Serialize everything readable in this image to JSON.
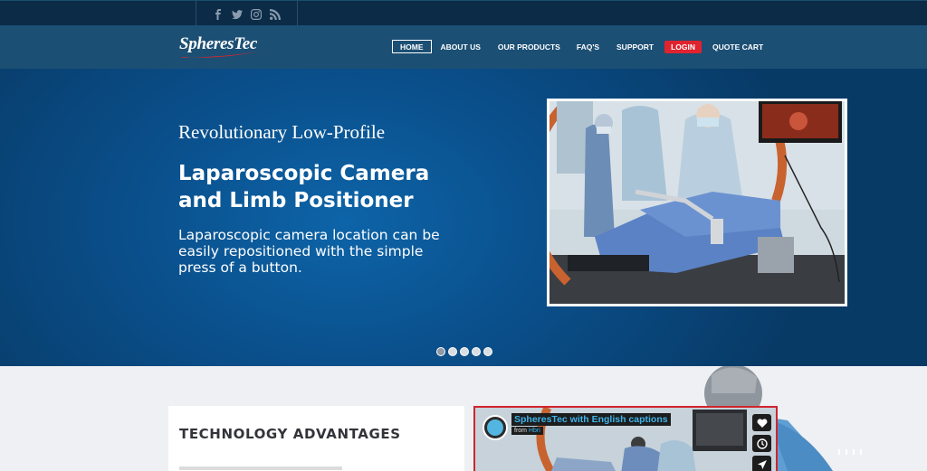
{
  "social": {
    "icons": [
      "facebook-icon",
      "twitter-icon",
      "instagram-icon",
      "rss-icon"
    ]
  },
  "header": {
    "logo_text": "SpheresTec",
    "menu": {
      "home": "HOME",
      "about": "ABOUT US",
      "products": "OUR PRODUCTS",
      "faq": "FAQ'S",
      "support": "SUPPORT",
      "login": "LOGIN",
      "quote_cart": "QUOTE CART"
    }
  },
  "hero": {
    "kicker": "Revolutionary Low-Profile",
    "title": "Laparoscopic Camera and Limb Positioner",
    "description": "Laparoscopic camera location can be easily repositioned with the simple press of a button.",
    "slide_count": 5,
    "active_slide": 1
  },
  "advantages": {
    "title": "TECHNOLOGY ADVANTAGES"
  },
  "video": {
    "title": "SpheresTec with English captions",
    "from_label": "from",
    "from_name": "Hbri"
  },
  "colors": {
    "topbar": "#0c2b47",
    "nav": "#1c4f74",
    "hero_center": "#0d64a8",
    "login_red": "#e0232f",
    "video_title_blue": "#3fb4ea"
  }
}
